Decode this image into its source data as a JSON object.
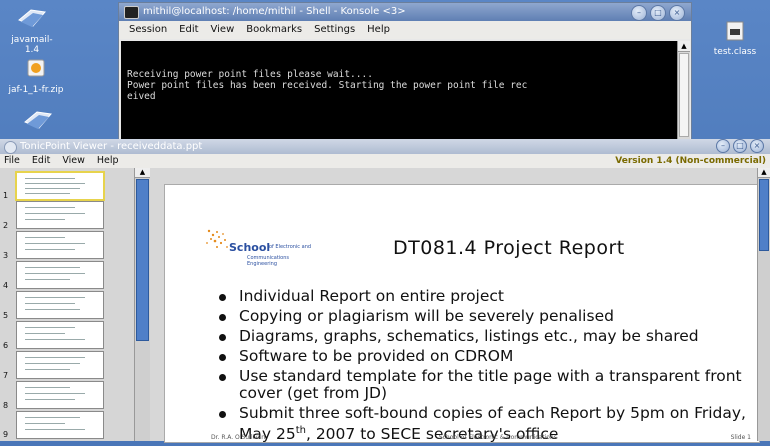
{
  "desktop": {
    "icons": [
      {
        "label": "javamail-1.4",
        "icon": "folder-icon"
      },
      {
        "label": "jaf-1_1-fr.zip",
        "icon": "zip-archive-icon"
      },
      {
        "label": "",
        "icon": "folder-icon"
      },
      {
        "label": "test.class",
        "icon": "document-icon"
      }
    ]
  },
  "konsole": {
    "title": "mithil@localhost: /home/mithil - Shell - Konsole <3>",
    "menu": [
      "Session",
      "Edit",
      "View",
      "Bookmarks",
      "Settings",
      "Help"
    ],
    "terminal_text": "Receiving power point files please wait....\nPower point files has been received. Starting the power point file rec\neived"
  },
  "viewer": {
    "title": "TonicPoint Viewer - receiveddata.ppt",
    "menu": [
      "File",
      "Edit",
      "View",
      "Help"
    ],
    "version": "Version 1.4 (Non-commercial)",
    "thumbnails": [
      "1",
      "2",
      "3",
      "4",
      "5",
      "6",
      "7",
      "8",
      "9"
    ],
    "selected_thumbnail": "1"
  },
  "slide": {
    "logo_text": "School",
    "logo_sub1": "of Electronic and",
    "logo_sub2": "Communications Engineering",
    "title": "DT081.4 Project Report",
    "bullets": [
      "Individual Report on entire project",
      "Copying or plagiarism will be severely penalised",
      "Diagrams, graphs, schematics, listings etc., may be shared",
      "Software to be provided on CDROM",
      "Use standard template for the title page with a transparent front cover (get from JD)"
    ],
    "last_bullet_pre": "Submit three soft-bound copies of each Report by 5pm on Friday, May 25",
    "last_bullet_sup": "th",
    "last_bullet_post": ", 2007 to SECE secretary's office",
    "footer_left": "Dr. R.A. O'Sullivan",
    "footer_center": "School of Electronic & Communications",
    "footer_right": "Slide 1"
  }
}
